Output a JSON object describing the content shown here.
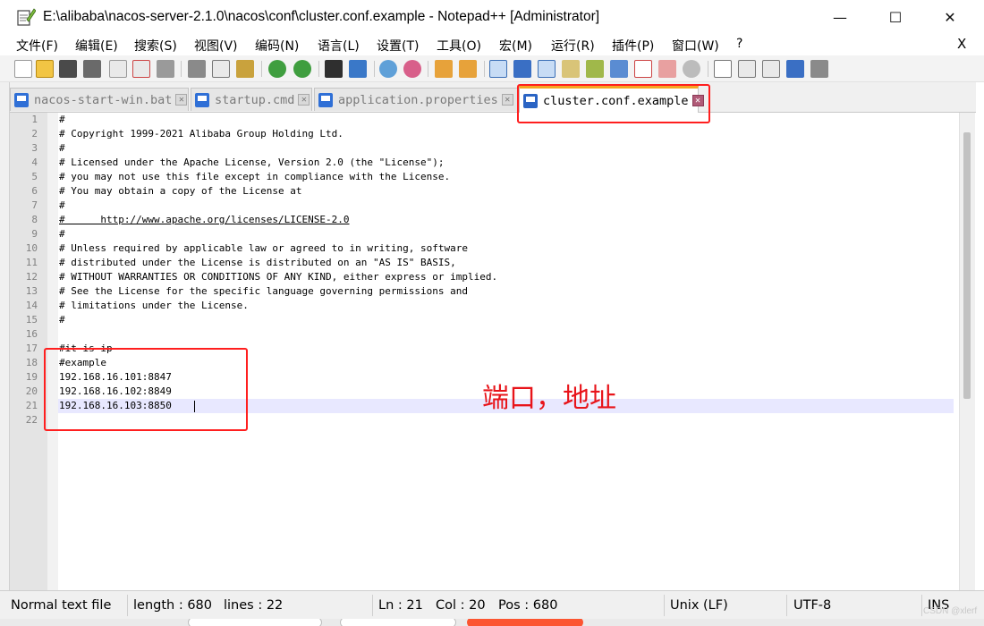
{
  "window": {
    "title": "E:\\alibaba\\nacos-server-2.1.0\\nacos\\conf\\cluster.conf.example - Notepad++ [Administrator]",
    "min_glyph": "—",
    "max_glyph": "☐",
    "close_glyph": "✕"
  },
  "menu": {
    "items": [
      "文件(F)",
      "编辑(E)",
      "搜索(S)",
      "视图(V)",
      "编码(N)",
      "语言(L)",
      "设置(T)",
      "工具(O)",
      "宏(M)",
      "运行(R)",
      "插件(P)",
      "窗口(W)",
      "?"
    ],
    "close_glyph": "X"
  },
  "toolbar": {
    "buttons": [
      "new-file-icon",
      "open-file-icon",
      "save-icon",
      "save-all-icon",
      "close-icon",
      "close-all-icon",
      "print-icon",
      "cut-icon",
      "copy-icon",
      "paste-icon",
      "undo-icon",
      "redo-icon",
      "find-icon",
      "replace-icon",
      "zoom-in-icon",
      "zoom-out-icon",
      "sync-vertical-icon",
      "sync-horizontal-icon",
      "word-wrap-icon",
      "show-all-characters-icon",
      "indent-guide-icon",
      "user-defined-language-icon",
      "document-map-icon",
      "function-list-icon",
      "folder-as-workspace-icon",
      "monitoring-icon",
      "record-macro-icon",
      "stop-recording-icon",
      "playback-macro-icon",
      "run-macro-multiple-icon",
      "save-macro-icon"
    ]
  },
  "tabs": [
    {
      "label": "nacos-start-win.bat",
      "active": false
    },
    {
      "label": "startup.cmd",
      "active": false
    },
    {
      "label": "application.properties",
      "active": false
    },
    {
      "label": "cluster.conf.example",
      "active": true
    }
  ],
  "editor": {
    "lines": [
      "#",
      "# Copyright 1999-2021 Alibaba Group Holding Ltd.",
      "#",
      "# Licensed under the Apache License, Version 2.0 (the \"License\");",
      "# you may not use this file except in compliance with the License.",
      "# You may obtain a copy of the License at",
      "#",
      "#      http://www.apache.org/licenses/LICENSE-2.0",
      "#",
      "# Unless required by applicable law or agreed to in writing, software",
      "# distributed under the License is distributed on an \"AS IS\" BASIS,",
      "# WITHOUT WARRANTIES OR CONDITIONS OF ANY KIND, either express or implied.",
      "# See the License for the specific language governing permissions and",
      "# limitations under the License.",
      "#",
      "",
      "#it is ip",
      "#example",
      "192.168.16.101:8847",
      "192.168.16.102:8849",
      "192.168.16.103:8850",
      ""
    ],
    "current_line": 21
  },
  "annotation": {
    "text": "端口，地址",
    "color": "#e8141a"
  },
  "status": {
    "file_type": "Normal text file",
    "length": "length : 680",
    "lines": "lines : 22",
    "ln": "Ln : 21",
    "col": "Col : 20",
    "pos": "Pos : 680",
    "eol": "Unix (LF)",
    "encoding": "UTF-8",
    "mode": "INS"
  },
  "watermark": "CSDN @xlerf",
  "colors": {
    "annotation_red": "#ff1f1f",
    "active_tab_accent": "#f5a623",
    "current_line": "#e8e8ff",
    "tab_icon_blue": "#2f6fd6"
  }
}
